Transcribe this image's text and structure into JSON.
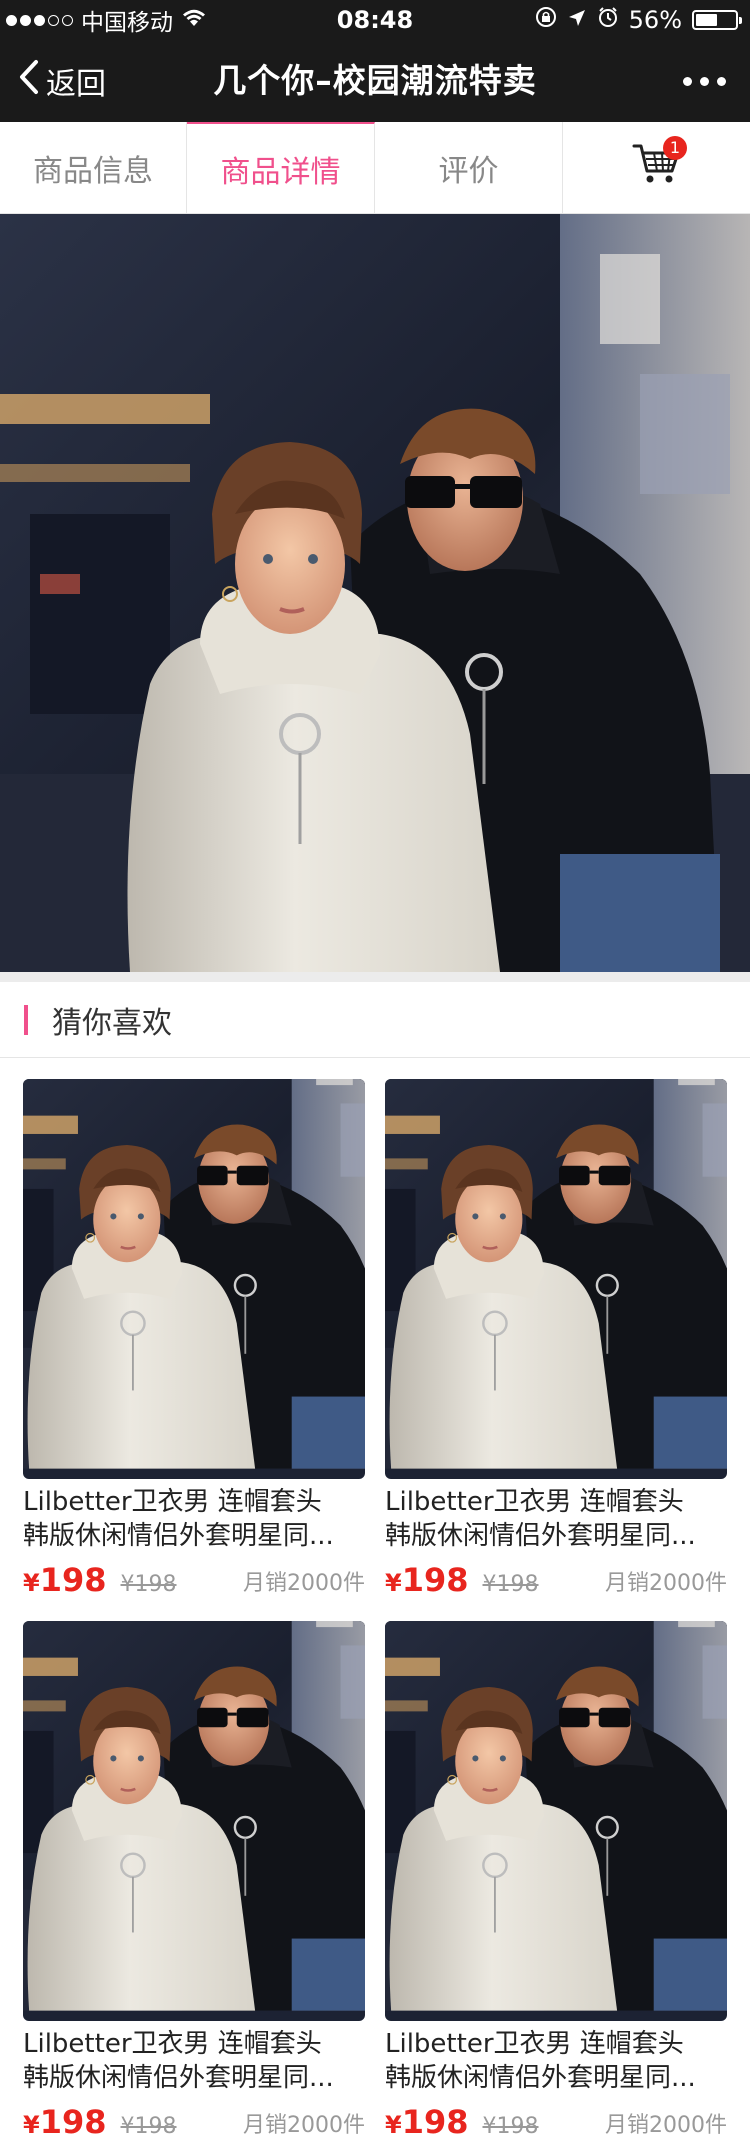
{
  "status_bar": {
    "carrier": "中国移动",
    "time": "08:48",
    "battery_text": "56%",
    "battery_level": 0.56,
    "signal_bars_on": 3,
    "signal_bars_total": 5
  },
  "nav": {
    "back_label": "返回",
    "title": "几个你–校园潮流特卖"
  },
  "tabs": [
    {
      "label": "商品信息",
      "active": false
    },
    {
      "label": "商品详情",
      "active": true
    },
    {
      "label": "评价",
      "active": false
    }
  ],
  "cart": {
    "badge": "1"
  },
  "guess": {
    "title": "猜你喜欢"
  },
  "products": [
    {
      "title_line1": "Lilbetter卫衣男 连帽套头",
      "title_line2": "韩版休闲情侣外套明星同...",
      "price_symbol": "¥",
      "price": "198",
      "old_price": "¥198",
      "sales": "月销2000件"
    },
    {
      "title_line1": "Lilbetter卫衣男 连帽套头",
      "title_line2": "韩版休闲情侣外套明星同...",
      "price_symbol": "¥",
      "price": "198",
      "old_price": "¥198",
      "sales": "月销2000件"
    },
    {
      "title_line1": "Lilbetter卫衣男 连帽套头",
      "title_line2": "韩版休闲情侣外套明星同...",
      "price_symbol": "¥",
      "price": "198",
      "old_price": "¥198",
      "sales": "月销2000件"
    },
    {
      "title_line1": "Lilbetter卫衣男 连帽套头",
      "title_line2": "韩版休闲情侣外套明星同...",
      "price_symbol": "¥",
      "price": "198",
      "old_price": "¥198",
      "sales": "月销2000件"
    }
  ],
  "colors": {
    "accent": "#f0508c",
    "price": "#e8251e",
    "header_bg": "#1a1a1a",
    "muted": "#999999"
  },
  "icons": {
    "back": "chevron-left-icon",
    "more": "more-dots-icon",
    "cart": "shopping-cart-icon",
    "wifi": "wifi-icon",
    "location": "location-arrow-icon",
    "alarm": "alarm-icon",
    "lock": "rotation-lock-icon",
    "battery": "battery-icon"
  }
}
